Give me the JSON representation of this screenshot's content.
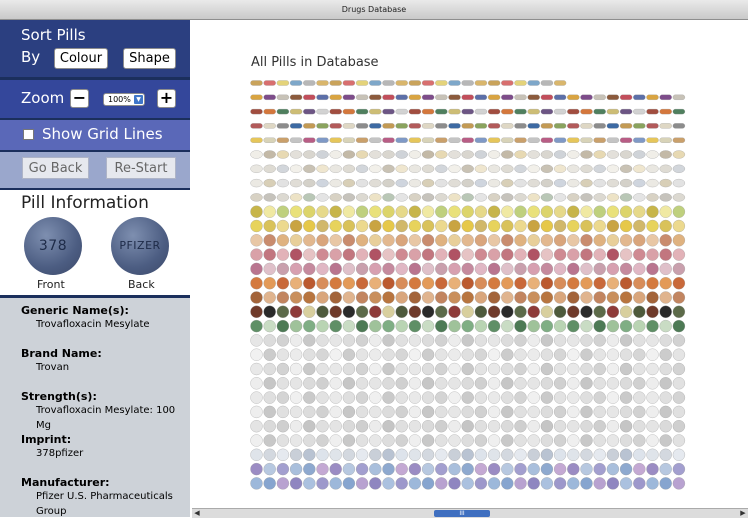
{
  "window": {
    "title": "Drugs Database"
  },
  "sort": {
    "label_line1": "Sort Pills",
    "label_line2": "By",
    "colour_button": "Colour",
    "shape_button": "Shape"
  },
  "zoom": {
    "label": "Zoom",
    "minus": "−",
    "value": "100%",
    "plus": "+"
  },
  "grid": {
    "label": "Show Grid Lines",
    "checked": false
  },
  "nav": {
    "back": "Go Back",
    "restart": "Re-Start"
  },
  "pill_info": {
    "heading": "Pill Information",
    "front_label": "Front",
    "back_label": "Back",
    "front_imprint": "378",
    "back_imprint": "PFIZER"
  },
  "details": {
    "generic_label": "Generic Name(s):",
    "generic_value": "Trovafloxacin Mesylate",
    "brand_label": "Brand Name:",
    "brand_value": "Trovan",
    "strength_label": "Strength(s):",
    "strength_value": "Trovafloxacin Mesylate: 100 Mg",
    "imprint_label": "Imprint:",
    "imprint_value": "378pfizer",
    "manufacturer_label": "Manufacturer:",
    "manufacturer_value": "Pfizer U.S. Pharmaceuticals Group"
  },
  "main": {
    "title": "All Pills in Database",
    "scroll_thumb": "III"
  },
  "palette": {
    "sidebar_dark": "#1b2f5c",
    "sort_panel": "#2b3f80",
    "zoom_panel": "#34479b",
    "grid_panel": "#5a68b8",
    "nav_panel": "#9aa7cc",
    "details_panel": "#cdd2d8"
  },
  "pill_rows": [
    {
      "count": 24,
      "shape": "capsule",
      "colors": [
        "#c9a35b",
        "#d86f6f",
        "#e4d37a",
        "#7ea7c9",
        "#b7b7b7",
        "#d9b66c"
      ]
    },
    {
      "count": 33,
      "shape": "capsule",
      "colors": [
        "#8b5a3c",
        "#c24e5b",
        "#5c6fa8",
        "#d9a441",
        "#7d4c8a",
        "#c7c2b7"
      ]
    },
    {
      "count": 33,
      "shape": "capsule",
      "colors": [
        "#a14d3f",
        "#d4773c",
        "#4f7f5e",
        "#cdbd75",
        "#6c5584",
        "#d2d2d2"
      ]
    },
    {
      "count": 33,
      "shape": "capsule",
      "colors": [
        "#3d6aa3",
        "#c39a54",
        "#8aa35e",
        "#b25a5a",
        "#ded7c4",
        "#8c8c8c"
      ]
    },
    {
      "count": 33,
      "shape": "capsule",
      "colors": [
        "#e6c65a",
        "#d8d3b8",
        "#caa06b",
        "#c4c4c4",
        "#b85d85",
        "#7f99c6"
      ]
    },
    {
      "count": 33,
      "shape": "oval",
      "colors": [
        "#e3e0da",
        "#d9d6cf",
        "#cfd3d8",
        "#f0eee8",
        "#c3b9a7",
        "#e7d9b3"
      ]
    },
    {
      "count": 33,
      "shape": "oval",
      "colors": [
        "#e9e7e1",
        "#dedbd3",
        "#d2d6db",
        "#f2f0ea",
        "#c9c2b4",
        "#efe6cf"
      ]
    },
    {
      "count": 33,
      "shape": "oval",
      "colors": [
        "#e0ddd6",
        "#d4d1c9",
        "#cfd5de",
        "#ebe9e3",
        "#d8cfb7",
        "#e2e2e2"
      ]
    },
    {
      "count": 33,
      "shape": "oval",
      "colors": [
        "#d8d2c4",
        "#c6c3bc",
        "#dcd9d1",
        "#ede3c6",
        "#b9c7b6",
        "#e4e4e4"
      ]
    },
    {
      "count": 33,
      "shape": "round",
      "colors": [
        "#e9e17a",
        "#dcd46b",
        "#e6d98a",
        "#c7b54a",
        "#f0e9a3",
        "#bfd07e"
      ]
    },
    {
      "count": 33,
      "shape": "round",
      "colors": [
        "#e7d35c",
        "#d9c25a",
        "#ecd98e",
        "#c9a442",
        "#e6c84a",
        "#d1b86a"
      ]
    },
    {
      "count": 33,
      "shape": "round",
      "colors": [
        "#e8cf9a",
        "#e2b88f",
        "#d9a57c",
        "#e8c7a5",
        "#c98c6e",
        "#dfb280"
      ]
    },
    {
      "count": 33,
      "shape": "round",
      "colors": [
        "#d9a1a8",
        "#c2767f",
        "#e2b2b8",
        "#b05364",
        "#e6c3c4",
        "#cf8a92"
      ]
    },
    {
      "count": 33,
      "shape": "round",
      "colors": [
        "#d7a0b0",
        "#c58a9e",
        "#e0b7c4",
        "#b9758f",
        "#dfc0c9",
        "#c9a0ad"
      ]
    },
    {
      "count": 33,
      "shape": "round",
      "colors": [
        "#d47a3f",
        "#e39a58",
        "#c9693a",
        "#e8b078",
        "#bb5a30",
        "#d88d5a"
      ]
    },
    {
      "count": 33,
      "shape": "round",
      "colors": [
        "#c98f5c",
        "#b8753f",
        "#d9a67c",
        "#a3643a",
        "#e0b48e",
        "#c28560"
      ]
    },
    {
      "count": 33,
      "shape": "round",
      "colors": [
        "#6f3a2a",
        "#2a2a2a",
        "#5c6a49",
        "#8e3b39",
        "#d8cf9e",
        "#4e5a3c"
      ]
    },
    {
      "count": 33,
      "shape": "round",
      "colors": [
        "#9fc29a",
        "#7fae84",
        "#b9d4b3",
        "#5f8f66",
        "#c9dcc4",
        "#4d7a55"
      ]
    },
    {
      "count": 33,
      "shape": "round",
      "colors": [
        "#e6e6e6",
        "#dcdcdc",
        "#d2d2d2",
        "#ececec",
        "#c8c8c8",
        "#e0e0e0"
      ]
    },
    {
      "count": 33,
      "shape": "round",
      "colors": [
        "#ebebeb",
        "#e0e0e0",
        "#d6d6d6",
        "#f1f1f1",
        "#cccccc",
        "#e4e4e4"
      ]
    },
    {
      "count": 33,
      "shape": "round",
      "colors": [
        "#e8e8e8",
        "#dedede",
        "#d3d3d3",
        "#efefef",
        "#c9c9c9",
        "#e3e3e3"
      ]
    },
    {
      "count": 33,
      "shape": "round",
      "colors": [
        "#e5e5e5",
        "#dbdbdb",
        "#d0d0d0",
        "#ededed",
        "#c6c6c6",
        "#e1e1e1"
      ]
    },
    {
      "count": 33,
      "shape": "round",
      "colors": [
        "#e9e9e9",
        "#dfdfdf",
        "#d4d4d4",
        "#f0f0f0",
        "#cacaca",
        "#e2e2e2"
      ]
    },
    {
      "count": 33,
      "shape": "round",
      "colors": [
        "#e6e6e6",
        "#dcdcdc",
        "#d1d1d1",
        "#eeeeee",
        "#c7c7c7",
        "#e0e0e0"
      ]
    },
    {
      "count": 33,
      "shape": "round",
      "colors": [
        "#e4e4e4",
        "#dadada",
        "#cfcfcf",
        "#ececec",
        "#c5c5c5",
        "#dfdfdf"
      ]
    },
    {
      "count": 33,
      "shape": "round",
      "colors": [
        "#e7e7e7",
        "#dddddd",
        "#d2d2d2",
        "#efefef",
        "#c8c8c8",
        "#e1e1e1"
      ]
    },
    {
      "count": 33,
      "shape": "round",
      "colors": [
        "#dfe4ea",
        "#d3d8df",
        "#e5e9ef",
        "#c9cfd8",
        "#b9c3d2",
        "#dde3eb"
      ]
    },
    {
      "count": 33,
      "shape": "round",
      "colors": [
        "#a9bfdc",
        "#8ea9cf",
        "#c4a9d3",
        "#9b8cc3",
        "#b7c8e0",
        "#a39fcf"
      ]
    },
    {
      "count": 33,
      "shape": "round",
      "colors": [
        "#9db8da",
        "#87a5cf",
        "#b8a2d0",
        "#8f86c0",
        "#abc1df",
        "#9d98cb"
      ]
    }
  ]
}
